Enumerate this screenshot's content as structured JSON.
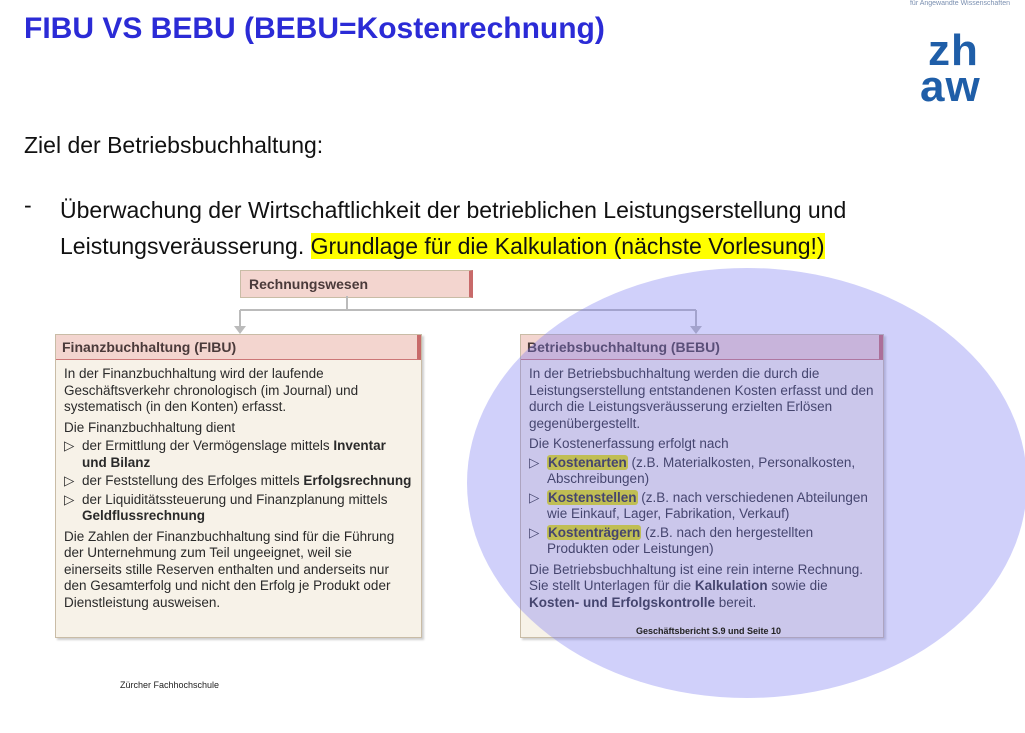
{
  "slide": {
    "title": "FIBU VS BEBU (BEBU=Kostenrechnung)",
    "subtitle": "Ziel der Betriebsbuchhaltung:",
    "bullet_dash": "-",
    "bullet_text": "Überwachung der Wirtschaftlichkeit der betrieblichen Leistungserstellung und Leistungsveräusserung.",
    "bullet_highlight": "Grundlage für die Kalkulation (nächste Vorlesung!)",
    "footer": "Zürcher  Fachhochschule",
    "source": "Geschäftsbericht S.9 und Seite 10"
  },
  "logo": {
    "top_text": "für Angewandte Wissenschaften",
    "line1": "zh",
    "line2": "aw",
    "color": "#1f5ea8"
  },
  "figure": {
    "root_label": "Rechnungswesen",
    "fibu": {
      "header": "Finanzbuchhaltung (FIBU)",
      "intro": "In der Finanzbuchhaltung wird der laufende Geschäftsverkehr chronologisch (im Journal) und systematisch (in den Konten) erfasst.",
      "dient": "Die Finanzbuchhaltung dient",
      "items": [
        {
          "pre": "der Ermittlung der Vermögenslage mittels ",
          "kw": "Inventar und Bilanz"
        },
        {
          "pre": "der Feststellung des Erfolges mittels ",
          "kw": "Erfolgsrechnung"
        },
        {
          "pre": "der Liquiditätssteuerung und Finanzplanung mittels ",
          "kw": "Geldflussrechnung"
        }
      ],
      "outro": "Die Zahlen der Finanzbuchhaltung sind für die Führung der Unternehmung zum Teil ungeeignet, weil sie einerseits stille Reserven enthalten und anderseits nur den Gesamterfolg und nicht den Erfolg je Produkt oder Dienstleistung ausweisen."
    },
    "bebu": {
      "header": "Betriebsbuchhaltung (BEBU)",
      "intro": "In der Betriebsbuchhaltung werden die durch die Leistungserstellung entstandenen Kosten erfasst und den durch die Leistungsveräusserung erzielten Erlösen gegenübergestellt.",
      "erfassung": "Die Kostenerfassung erfolgt nach",
      "items": [
        {
          "kw": "Kostenarten",
          "post": " (z.B. Materialkosten, Personalkosten, Abschreibungen)"
        },
        {
          "kw": "Kostenstellen",
          "post": " (z.B. nach verschiedenen Abteilungen wie Einkauf, Lager, Fabrikation, Verkauf)"
        },
        {
          "kw": "Kostenträgern",
          "post": " (z.B. nach den hergestellten Produkten oder Leistungen)"
        }
      ],
      "outro_pre": "Die Betriebsbuchhaltung ist eine rein interne Rechnung. Sie stellt Unterlagen für die ",
      "outro_kw1": "Kalkulation",
      "outro_mid": " sowie die ",
      "outro_kw2": "Kosten- und Erfolgskontrolle",
      "outro_post": " bereit."
    },
    "arrow_glyph": "▷",
    "highlight_color": "#ffff00",
    "overlay_color": "#7878f0"
  }
}
